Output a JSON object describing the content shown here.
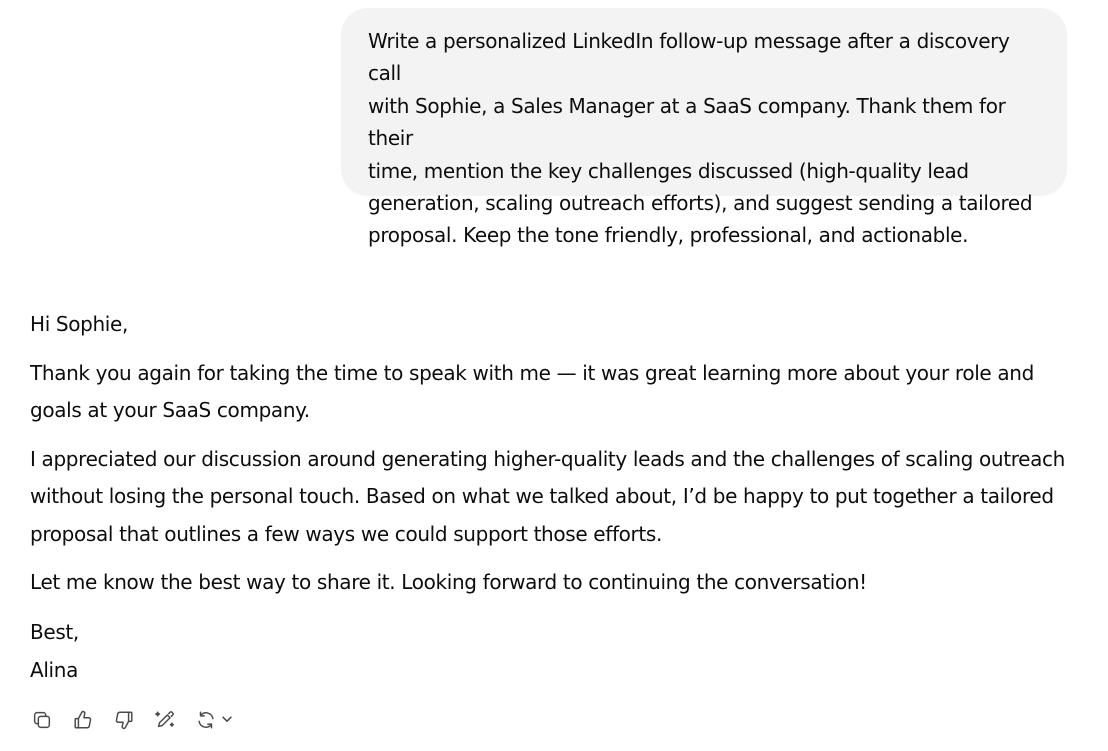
{
  "user_message": {
    "lines": [
      "Write a personalized LinkedIn follow-up message after a discovery call",
      "with Sophie, a Sales Manager at a SaaS company. Thank them for their",
      "time, mention the key challenges discussed (high-quality lead",
      "generation, scaling outreach efforts), and suggest sending a tailored",
      "proposal. Keep the tone friendly, professional, and actionable."
    ]
  },
  "assistant_message": {
    "greeting": "Hi Sophie,",
    "paragraph1": {
      "lines": [
        "Thank you again for taking the time to speak with me — it was great learning more about your role and",
        "goals at your SaaS company."
      ]
    },
    "paragraph2": {
      "lines": [
        "I appreciated our discussion around generating higher-quality leads and the challenges of scaling outreach",
        "without losing the personal touch. Based on what we talked about, I’d be happy to put together a tailored",
        "proposal that outlines a few ways we could support those efforts."
      ]
    },
    "paragraph3": "Let me know the best way to share it. Looking forward to continuing the conversation!",
    "signoff": "Best,",
    "signature": "Alina"
  },
  "actions": {
    "icons": [
      "copy-icon",
      "thumbs-up-icon",
      "thumbs-down-icon",
      "edit-icon",
      "regenerate-icon",
      "chevron-down-icon"
    ],
    "icon_color": "#4a4a4a"
  },
  "colors": {
    "user_bubble_bg": "#f3f3f3",
    "text": "#0d0d0d",
    "background": "#ffffff"
  }
}
